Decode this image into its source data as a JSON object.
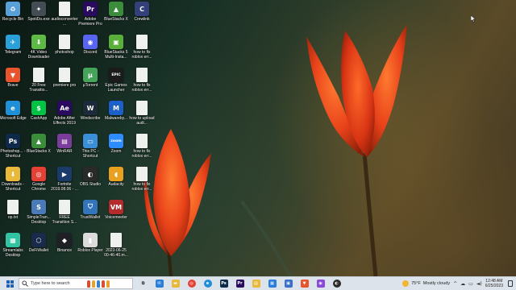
{
  "desktop": {
    "icons": [
      {
        "label": "Recycle Bin",
        "color": "#5aa0d8",
        "glyph": "♻",
        "col": 0,
        "row": 0
      },
      {
        "label": "SpotiDo.exe",
        "color": "#444c54",
        "glyph": "✦",
        "col": 1,
        "row": 0
      },
      {
        "label": "audioconverter...",
        "color": "#eef1ee",
        "glyph": "",
        "col": 2,
        "row": 0
      },
      {
        "label": "Adobe Premiere Pro",
        "color": "#2a0a5e",
        "glyph": "Pr",
        "col": 3,
        "row": 0
      },
      {
        "label": "BlueStacks X",
        "color": "#3b8d3c",
        "glyph": "▲",
        "col": 4,
        "row": 0
      },
      {
        "label": "Crewlink",
        "color": "#33407a",
        "glyph": "C",
        "col": 5,
        "row": 0
      },
      {
        "label": "Telegram",
        "color": "#2a9fd8",
        "glyph": "✈",
        "col": 0,
        "row": 1
      },
      {
        "label": "4K Video Downloader",
        "color": "#5dbb45",
        "glyph": "⬇",
        "col": 1,
        "row": 1
      },
      {
        "label": "photoshop",
        "color": "#eef1ee",
        "glyph": "",
        "col": 2,
        "row": 1
      },
      {
        "label": "Discord",
        "color": "#5865f2",
        "glyph": "◉",
        "col": 3,
        "row": 1
      },
      {
        "label": "BlueStacks 5 Multi-Insta...",
        "color": "#5aae3a",
        "glyph": "▣",
        "col": 4,
        "row": 1
      },
      {
        "label": "how to fix roblox err...",
        "color": "#eef1ee",
        "glyph": "",
        "col": 5,
        "row": 1
      },
      {
        "label": "Brave",
        "color": "#e8552c",
        "glyph": "▼",
        "col": 0,
        "row": 2
      },
      {
        "label": "20 Free Transitio...",
        "color": "#eef1ee",
        "glyph": "",
        "col": 1,
        "row": 2
      },
      {
        "label": "premiere pro",
        "color": "#eef1ee",
        "glyph": "",
        "col": 2,
        "row": 2
      },
      {
        "label": "µTorrent",
        "color": "#46a35a",
        "glyph": "µ",
        "col": 3,
        "row": 2
      },
      {
        "label": "Epic Games Launcher",
        "color": "#1b1b1b",
        "glyph": "EPIC",
        "col": 4,
        "row": 2
      },
      {
        "label": "how to fix roblox err...",
        "color": "#eef1ee",
        "glyph": "",
        "col": 5,
        "row": 2
      },
      {
        "label": "Microsoft Edge",
        "color": "#1f8fd8",
        "glyph": "e",
        "col": 0,
        "row": 3
      },
      {
        "label": "CashApp",
        "color": "#00c244",
        "glyph": "$",
        "col": 1,
        "row": 3
      },
      {
        "label": "Adobe After Effects 2019",
        "color": "#2a0a5e",
        "glyph": "Ae",
        "col": 2,
        "row": 3
      },
      {
        "label": "Windscribe",
        "color": "#1c2a3a",
        "glyph": "W",
        "col": 3,
        "row": 3
      },
      {
        "label": "Malwareby...",
        "color": "#1d5fc8",
        "glyph": "M",
        "col": 4,
        "row": 3
      },
      {
        "label": "how to upload audi...",
        "color": "#eef1ee",
        "glyph": "",
        "col": 5,
        "row": 3
      },
      {
        "label": "Photoshop... - Shortcut",
        "color": "#0d2a4a",
        "glyph": "Ps",
        "col": 0,
        "row": 4
      },
      {
        "label": "BlueStacks X",
        "color": "#3b8d3c",
        "glyph": "▲",
        "col": 1,
        "row": 4
      },
      {
        "label": "WinRAR",
        "color": "#7a3d9a",
        "glyph": "▤",
        "col": 2,
        "row": 4
      },
      {
        "label": "This PC - Shortcut",
        "color": "#3a8fd8",
        "glyph": "▭",
        "col": 3,
        "row": 4
      },
      {
        "label": "Zoom",
        "color": "#2d8cff",
        "glyph": "zoom",
        "col": 4,
        "row": 4
      },
      {
        "label": "how to fix roblox err...",
        "color": "#eef1ee",
        "glyph": "",
        "col": 5,
        "row": 4
      },
      {
        "label": "Downloads - Shortcut",
        "color": "#e8b93a",
        "glyph": "⬇",
        "col": 0,
        "row": 5
      },
      {
        "label": "Google Chrome",
        "color": "#e44134",
        "glyph": "◎",
        "col": 1,
        "row": 5
      },
      {
        "label": "Fortnite 2019.08.06 - ...",
        "color": "#1b3b6a",
        "glyph": "▶",
        "col": 2,
        "row": 5
      },
      {
        "label": "OBS Studio",
        "color": "#2a2a2a",
        "glyph": "◐",
        "col": 3,
        "row": 5
      },
      {
        "label": "Audacity",
        "color": "#e8a020",
        "glyph": "◖",
        "col": 4,
        "row": 5
      },
      {
        "label": "how to fix roblox err...",
        "color": "#eef1ee",
        "glyph": "",
        "col": 5,
        "row": 5
      },
      {
        "label": "op.txt",
        "color": "#eef1ee",
        "glyph": "",
        "col": 0,
        "row": 6
      },
      {
        "label": "SimpleTran... Desktop",
        "color": "#4a7ab8",
        "glyph": "S",
        "col": 1,
        "row": 6
      },
      {
        "label": "FREE Transition S...",
        "color": "#eef1ee",
        "glyph": "",
        "col": 2,
        "row": 6
      },
      {
        "label": "TrustWallet",
        "color": "#3375bb",
        "glyph": "⛉",
        "col": 3,
        "row": 6
      },
      {
        "label": "Voicemeeter",
        "color": "#b52a2a",
        "glyph": "VM",
        "col": 4,
        "row": 6
      },
      {
        "label": "Streamlabs Desktop",
        "color": "#31c3a2",
        "glyph": "▦",
        "col": 0,
        "row": 7
      },
      {
        "label": "DeFiWallet",
        "color": "#1a2a4a",
        "glyph": "⬡",
        "col": 1,
        "row": 7
      },
      {
        "label": "Binance",
        "color": "#1e2026",
        "glyph": "◆",
        "col": 2,
        "row": 7
      },
      {
        "label": "Roblox Player",
        "color": "#dcdcdc",
        "glyph": "▮",
        "col": 3,
        "row": 7
      },
      {
        "label": "2023-06-25 00-46-40.m...",
        "color": "#eef1ee",
        "glyph": "",
        "col": 4,
        "row": 7
      }
    ]
  },
  "taskbar": {
    "search_placeholder": "Type here to search",
    "pinned": [
      {
        "name": "task-view",
        "color": "#dde3ea",
        "glyph": "⧉"
      },
      {
        "name": "mail",
        "color": "#2a7fd8",
        "glyph": "✉"
      },
      {
        "name": "file-explorer",
        "color": "#e8b93a",
        "glyph": "▬"
      },
      {
        "name": "chrome",
        "color": "#e44134",
        "glyph": "◎"
      },
      {
        "name": "edge",
        "color": "#1f8fd8",
        "glyph": "e"
      },
      {
        "name": "photoshop",
        "color": "#0d2a4a",
        "glyph": "Ps"
      },
      {
        "name": "premiere",
        "color": "#2a0a5e",
        "glyph": "Pr"
      },
      {
        "name": "notes",
        "color": "#e8b93a",
        "glyph": "▤"
      },
      {
        "name": "store",
        "color": "#2a7fd8",
        "glyph": "▦"
      },
      {
        "name": "photos",
        "color": "#3b6fc8",
        "glyph": "▣"
      },
      {
        "name": "brave",
        "color": "#e8552c",
        "glyph": "▼"
      },
      {
        "name": "messenger",
        "color": "#8a4ad8",
        "glyph": "◉"
      },
      {
        "name": "obs",
        "color": "#2a2a2a",
        "glyph": "◐"
      }
    ],
    "weather_temp": "75°F",
    "weather_desc": "Mostly cloudy",
    "time": "12:48 AM",
    "date": "6/25/2023"
  }
}
